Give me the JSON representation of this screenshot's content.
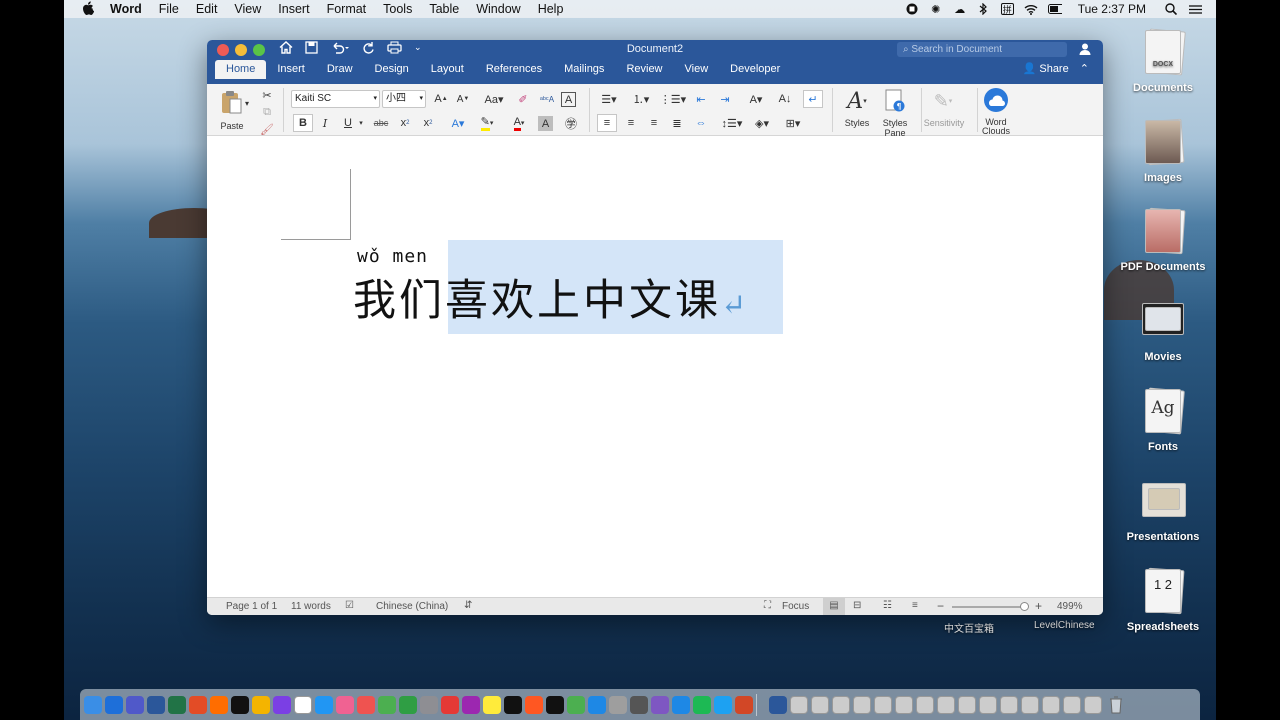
{
  "menubar": {
    "app": "Word",
    "menus": [
      "File",
      "Edit",
      "View",
      "Insert",
      "Format",
      "Tools",
      "Table",
      "Window",
      "Help"
    ],
    "status_icons": [
      "record-icon",
      "settings-icon",
      "cloud-icon",
      "bluetooth-icon",
      "input-method-icon",
      "wifi-icon",
      "battery-icon"
    ],
    "input_method": "拼",
    "clock": "Tue 2:37 PM"
  },
  "window": {
    "title": "Document2",
    "search_placeholder": "Search in Document",
    "tabs": [
      "Home",
      "Insert",
      "Draw",
      "Design",
      "Layout",
      "References",
      "Mailings",
      "Review",
      "View",
      "Developer"
    ],
    "active_tab": "Home",
    "share_label": "Share"
  },
  "ribbon": {
    "paste_label": "Paste",
    "font_name": "Kaiti SC",
    "font_size": "小四",
    "bold": "B",
    "italic": "I",
    "underline": "U",
    "strikethrough": "abc",
    "styles_label": "Styles",
    "styles_pane_label": "Styles Pane",
    "sensitivity_label": "Sensitivity",
    "word_clouds_label": "Word Clouds"
  },
  "document": {
    "pinyin": "wǒ men",
    "unselected_text": "我们",
    "selected_text": "喜欢上中文课",
    "paragraph_mark": "↵"
  },
  "statusbar": {
    "page": "Page 1 of 1",
    "words": "11 words",
    "language": "Chinese (China)",
    "focus": "Focus",
    "zoom": "499%",
    "zoom_fraction": 0.95
  },
  "desktop": {
    "items": [
      {
        "label": "Documents",
        "badge": "DOCX"
      },
      {
        "label": "Images",
        "badge": ""
      },
      {
        "label": "PDF Documents",
        "badge": ""
      },
      {
        "label": "Movies",
        "badge": ""
      },
      {
        "label": "Fonts",
        "badge": "Ag"
      },
      {
        "label": "Presentations",
        "badge": ""
      },
      {
        "label": "Spreadsheets",
        "badge": "1 2"
      }
    ],
    "extra_labels": [
      "中文百宝箱",
      "LevelChinese"
    ]
  },
  "dock": {
    "app_colors": [
      "#3a8ee6",
      "#1e6fd9",
      "#5059c9",
      "#2b579a",
      "#217346",
      "#e34c26",
      "#ff6d00",
      "#111111",
      "#f4b400",
      "#7b3fe4",
      "#ffffff",
      "#2196f3",
      "#f06292",
      "#ef5350",
      "#4caf50",
      "#2f9e44",
      "#8e8e93",
      "#e53935",
      "#9c27b0",
      "#ffeb3b",
      "#111111",
      "#ff5722",
      "#111111",
      "#4caf50",
      "#1e88e5",
      "#9e9e9e",
      "#555555",
      "#7e57c2",
      "#1e88e5",
      "#1db954",
      "#1da1f2",
      "#d24726",
      "#2b579a",
      "#cccccc",
      "#cccccc",
      "#cccccc",
      "#cccccc",
      "#cccccc",
      "#cccccc",
      "#cccccc",
      "#cccccc",
      "#cccccc",
      "#cccccc",
      "#cccccc",
      "#cccccc",
      "#cccccc",
      "#cccccc",
      "#cccccc"
    ]
  }
}
